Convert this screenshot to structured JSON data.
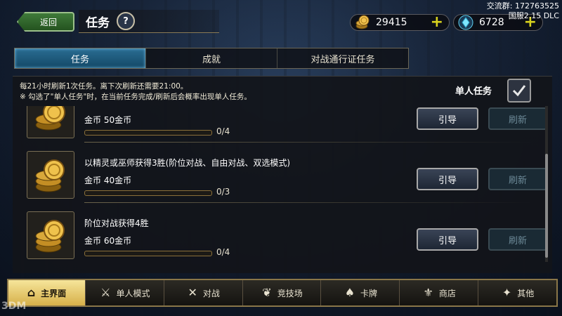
{
  "header": {
    "back_label": "返回",
    "title": "任务",
    "help_label": "?",
    "gold": "29415",
    "crystal": "6728",
    "corner_line1": "交流群: 172763525",
    "corner_line2": "国服2.15 DLC"
  },
  "tabs": [
    {
      "label": "任务",
      "active": true
    },
    {
      "label": "成就",
      "active": false
    },
    {
      "label": "对战通行证任务",
      "active": false
    }
  ],
  "notice": {
    "line1": "每21小时刷新1次任务。离下次刷新还需要21:00。",
    "line2": "※ 勾选了\"单人任务\"时，在当前任务完成/刷新后会概率出现单人任务。"
  },
  "solo": {
    "label": "单人任务",
    "checked": true
  },
  "tasks": [
    {
      "name": "",
      "reward": "金币 50金币",
      "progress": "0/4",
      "progress_fraction": 0,
      "guide": "引导",
      "refresh": "刷新"
    },
    {
      "name": "以精灵或巫师获得3胜(阶位对战、自由对战、双选模式)",
      "reward": "金币 40金币",
      "progress": "0/3",
      "progress_fraction": 0,
      "guide": "引导",
      "refresh": "刷新"
    },
    {
      "name": "阶位对战获得4胜",
      "reward": "金币 60金币",
      "progress": "0/4",
      "progress_fraction": 0,
      "guide": "引导",
      "refresh": "刷新"
    }
  ],
  "nav": [
    {
      "label": "主界面",
      "icon": "home-icon",
      "active": true
    },
    {
      "label": "单人模式",
      "icon": "sword-icon",
      "active": false
    },
    {
      "label": "对战",
      "icon": "crossed-swords-icon",
      "active": false
    },
    {
      "label": "竞技场",
      "icon": "laurel-icon",
      "active": false
    },
    {
      "label": "卡牌",
      "icon": "cards-icon",
      "active": false
    },
    {
      "label": "商店",
      "icon": "shop-icon",
      "active": false
    },
    {
      "label": "其他",
      "icon": "more-icon",
      "active": false
    }
  ],
  "watermark": "3DM"
}
